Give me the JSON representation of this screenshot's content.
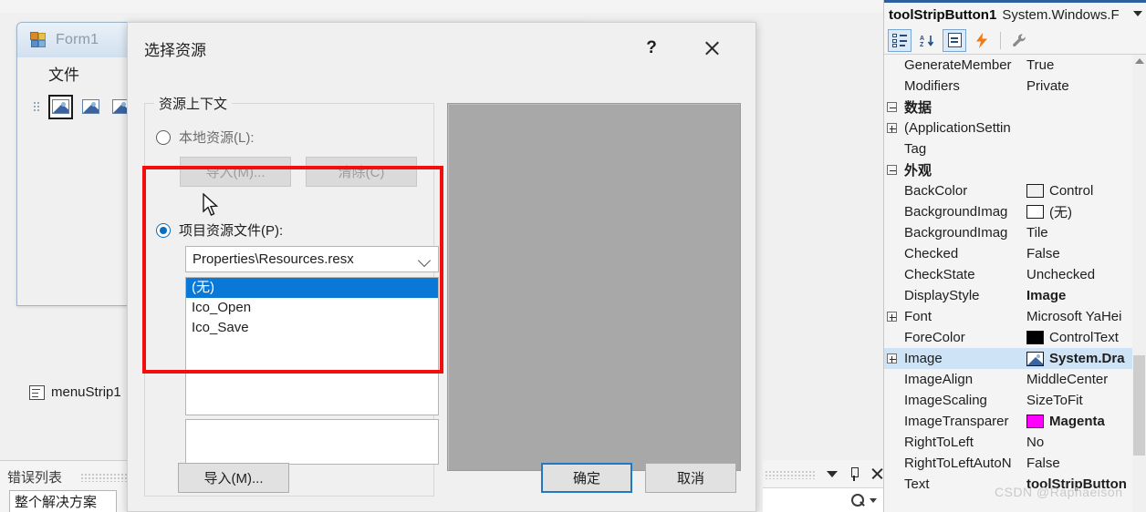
{
  "form_window": {
    "title": "Form1",
    "menu_items": [
      "文件"
    ],
    "toolbar_buttons": [
      "image-button-1",
      "image-button-2",
      "image-button-3",
      "image-button-4"
    ],
    "component_label": "menuStrip1"
  },
  "error_list": {
    "title": "错误列表",
    "scope_value": "整个解决方案"
  },
  "dialog": {
    "title": "选择资源",
    "help_label": "?",
    "groupbox_legend": "资源上下文",
    "local_resource_label": "本地资源(L):",
    "local_import_label": "导入(M)...",
    "local_clear_label": "清除(C)",
    "project_resource_label": "项目资源文件(P):",
    "resource_file_value": "Properties\\Resources.resx",
    "resource_list": [
      "(无)",
      "Ico_Open",
      "Ico_Save"
    ],
    "selected_resource": "(无)",
    "bottom_import_label": "导入(M)...",
    "ok_label": "确定",
    "cancel_label": "取消",
    "preview_color": "#a8a8a8"
  },
  "properties_panel": {
    "object_name": "toolStripButton1",
    "object_type": "System.Windows.F",
    "toolbar": [
      "categorized-icon",
      "alphabetical-icon",
      "property-page-icon",
      "events-icon",
      "wrench-icon"
    ],
    "rows": [
      {
        "name": "GenerateMember",
        "value": "True",
        "expander": "",
        "category": false,
        "selected": false,
        "bold": false,
        "swatch": ""
      },
      {
        "name": "Modifiers",
        "value": "Private",
        "expander": "",
        "category": false,
        "selected": false,
        "bold": false,
        "swatch": ""
      },
      {
        "name": "数据",
        "value": "",
        "expander": "minus",
        "category": true,
        "selected": false,
        "bold": false,
        "swatch": ""
      },
      {
        "name": "(ApplicationSettin",
        "value": "",
        "expander": "plus",
        "category": false,
        "selected": false,
        "bold": false,
        "swatch": ""
      },
      {
        "name": "Tag",
        "value": "",
        "expander": "",
        "category": false,
        "selected": false,
        "bold": false,
        "swatch": ""
      },
      {
        "name": "外观",
        "value": "",
        "expander": "minus",
        "category": true,
        "selected": false,
        "bold": false,
        "swatch": ""
      },
      {
        "name": "BackColor",
        "value": "Control",
        "expander": "",
        "category": false,
        "selected": false,
        "bold": false,
        "swatch": "#f0f0f0"
      },
      {
        "name": "BackgroundImag",
        "value": "(无)",
        "expander": "",
        "category": false,
        "selected": false,
        "bold": false,
        "swatch": "#ffffff"
      },
      {
        "name": "BackgroundImag",
        "value": "Tile",
        "expander": "",
        "category": false,
        "selected": false,
        "bold": false,
        "swatch": ""
      },
      {
        "name": "Checked",
        "value": "False",
        "expander": "",
        "category": false,
        "selected": false,
        "bold": false,
        "swatch": ""
      },
      {
        "name": "CheckState",
        "value": "Unchecked",
        "expander": "",
        "category": false,
        "selected": false,
        "bold": false,
        "swatch": ""
      },
      {
        "name": "DisplayStyle",
        "value": "Image",
        "expander": "",
        "category": false,
        "selected": false,
        "bold": true,
        "swatch": ""
      },
      {
        "name": "Font",
        "value": "Microsoft YaHei",
        "expander": "plus",
        "category": false,
        "selected": false,
        "bold": false,
        "swatch": ""
      },
      {
        "name": "ForeColor",
        "value": "ControlText",
        "expander": "",
        "category": false,
        "selected": false,
        "bold": false,
        "swatch": "#000000"
      },
      {
        "name": "Image",
        "value": "System.Dra",
        "expander": "plus",
        "category": false,
        "selected": true,
        "bold": true,
        "swatch": "image"
      },
      {
        "name": "ImageAlign",
        "value": "MiddleCenter",
        "expander": "",
        "category": false,
        "selected": false,
        "bold": false,
        "swatch": ""
      },
      {
        "name": "ImageScaling",
        "value": "SizeToFit",
        "expander": "",
        "category": false,
        "selected": false,
        "bold": false,
        "swatch": ""
      },
      {
        "name": "ImageTransparer",
        "value": "Magenta",
        "expander": "",
        "category": false,
        "selected": false,
        "bold": true,
        "swatch": "#ff00ff"
      },
      {
        "name": "RightToLeft",
        "value": "No",
        "expander": "",
        "category": false,
        "selected": false,
        "bold": false,
        "swatch": ""
      },
      {
        "name": "RightToLeftAutoN",
        "value": "False",
        "expander": "",
        "category": false,
        "selected": false,
        "bold": false,
        "swatch": ""
      },
      {
        "name": "Text",
        "value": "toolStripButton",
        "expander": "",
        "category": false,
        "selected": false,
        "bold": true,
        "swatch": ""
      }
    ]
  },
  "annotations": {
    "highlight_color": "#f40d0d"
  },
  "watermark": "CSDN @Raphaeison"
}
